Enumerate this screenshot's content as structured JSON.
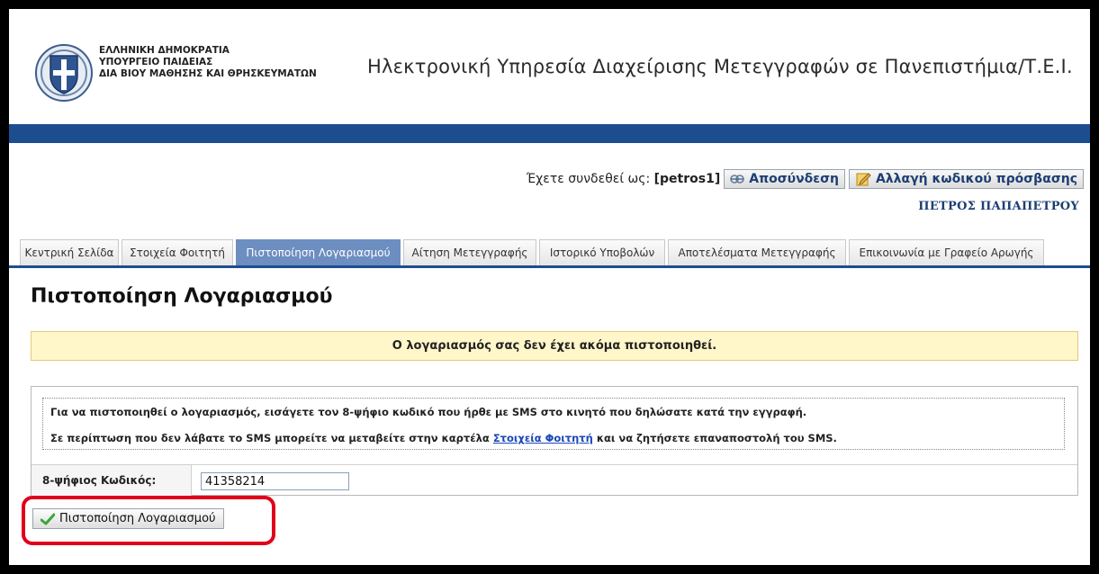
{
  "header": {
    "ministry_lines": [
      "ΕΛΛΗΝΙΚΗ ΔΗΜΟΚΡΑΤΙΑ",
      "ΥΠΟΥΡΓΕΙΟ ΠΑΙΔΕΙΑΣ",
      "ΔΙΑ ΒΙΟΥ ΜΑΘΗΣΗΣ ΚΑΙ ΘΡΗΣΚΕΥΜΑΤΩΝ"
    ],
    "site_title": "Ηλεκτρονική Υπηρεσία Διαχείρισης Μετεγγραφών σε Πανεπιστήμια/Τ.Ε.Ι."
  },
  "user": {
    "logged_in_label": "Έχετε συνδεθεί ως: ",
    "username": "[petros1]",
    "logout_label": "Αποσύνδεση",
    "change_password_label": "Αλλαγή κωδικού πρόσβασης",
    "full_name": "ΠΕΤΡΟΣ ΠΑΠΑΠΕΤΡΟΥ"
  },
  "tabs": [
    {
      "label": "Κεντρική Σελίδα",
      "active": false
    },
    {
      "label": "Στοιχεία Φοιτητή",
      "active": false
    },
    {
      "label": "Πιστοποίηση Λογαριασμού",
      "active": true
    },
    {
      "label": "Αίτηση Μετεγγραφής",
      "active": false
    },
    {
      "label": "Ιστορικό Υποβολών",
      "active": false
    },
    {
      "label": "Αποτελέσματα Μετεγγραφής",
      "active": false
    },
    {
      "label": "Επικοινωνία με Γραφείο Αρωγής",
      "active": false
    }
  ],
  "main": {
    "heading": "Πιστοποίηση Λογαριασμού",
    "notice": "Ο λογαριασμός σας δεν έχει ακόμα πιστοποιηθεί.",
    "info_line1": "Για να πιστοποιηθεί ο λογαριασμός, εισάγετε τον 8-ψήφιο κωδικό που ήρθε με SMS στο κινητό που δηλώσατε κατά την εγγραφή.",
    "info_line2_before": "Σε περίπτωση που δεν λάβατε το SMS μπορείτε να μεταβείτε στην καρτέλα ",
    "info_line2_link": "Στοιχεία Φοιτητή",
    "info_line2_after": " και να ζητήσετε επαναποστολή του SMS.",
    "code_label": "8-ψήφιος Κωδικός:",
    "code_value": "41358214",
    "verify_button": "Πιστοποίηση Λογαριασμού"
  },
  "colors": {
    "accent_blue": "#1c4e8f",
    "active_tab": "#6d8ec0",
    "notice_bg": "#fff6c9",
    "highlight": "#e0001a"
  }
}
